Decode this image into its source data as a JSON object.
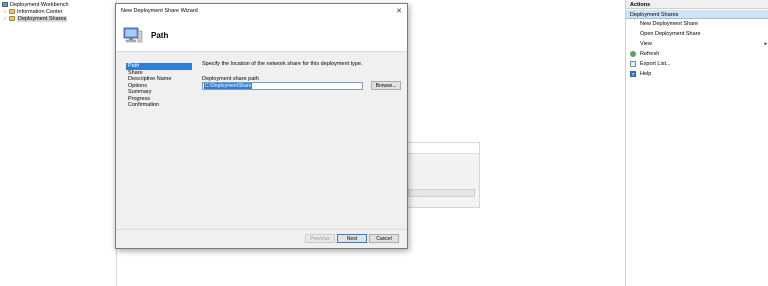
{
  "tree": {
    "root": "Deployment Workbench",
    "items": [
      "Information Center",
      "Deployment Shares"
    ]
  },
  "actions": {
    "header": "Actions",
    "section": "Deployment Shares",
    "items": [
      {
        "label": "New Deployment Share",
        "icon": "none"
      },
      {
        "label": "Open Deployment Share",
        "icon": "none"
      },
      {
        "label": "View",
        "icon": "none",
        "submenu": "▸"
      },
      {
        "label": "Refresh",
        "icon": "refresh-icon"
      },
      {
        "label": "Export List...",
        "icon": "export-icon"
      },
      {
        "label": "Help",
        "icon": "help-icon"
      }
    ]
  },
  "wizard": {
    "title": "New Deployment Share Wizard",
    "close_glyph": "✕",
    "heading": "Path",
    "steps": [
      "Path",
      "Share",
      "Descriptive Name",
      "Options",
      "Summary",
      "Progress",
      "Confirmation"
    ],
    "instruction": "Specify the location of the network share for this deployment type.",
    "path_label": "Deployment share path",
    "path_value": "C:\\DeploymentShare",
    "browse_label": "Browse...",
    "previous_label": "Previous",
    "next_label": "Next",
    "cancel_label": "Cancel"
  },
  "help_glyph": "?",
  "colors": {
    "selection": "#2f7fd6",
    "actions_section": "#cfe3f7"
  }
}
